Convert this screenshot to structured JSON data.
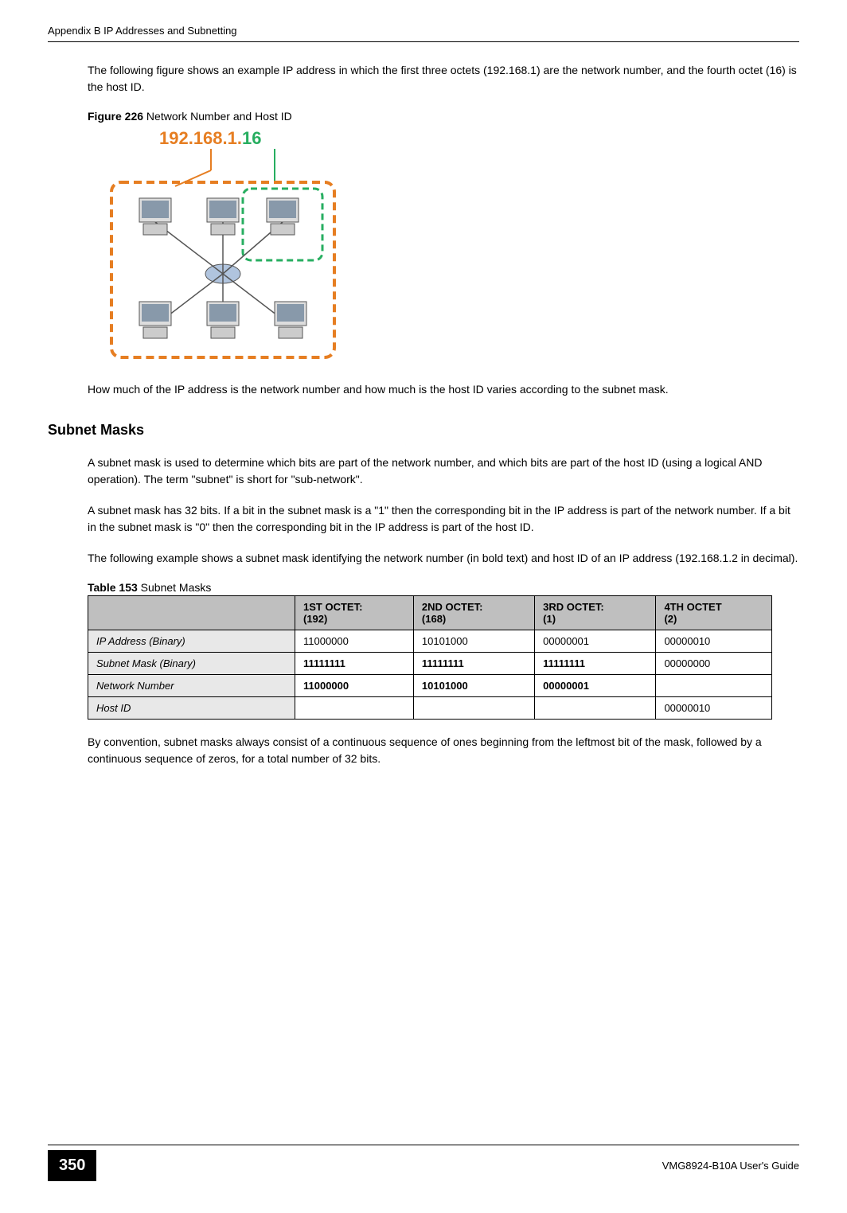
{
  "header": "Appendix B IP Addresses and Subnetting",
  "paragraph1": "The following figure shows an example IP address in which the first three octets (192.168.1) are the network number, and the fourth octet (16) is the host ID.",
  "figure_caption_bold": "Figure 226",
  "figure_caption_text": "   Network Number and Host ID",
  "ip_network": "192.168.1.",
  "ip_host": "16",
  "paragraph2": "How much of the IP address is the network number and how much is the host ID varies according to the subnet mask.",
  "section_heading": "Subnet Masks",
  "paragraph3": "A subnet mask is used to determine which bits are part of the network number, and which bits are part of the host ID (using a logical AND operation). The term \"subnet\" is short for \"sub-network\".",
  "paragraph4": "A subnet mask has 32 bits. If a bit in the subnet mask is a \"1\" then the corresponding bit in the IP address is part of the network number. If a bit in the subnet mask is \"0\" then the corresponding bit in the IP address is part of the host ID.",
  "paragraph5": "The following example shows a subnet mask identifying the network number (in bold text) and host ID of an IP address (192.168.1.2 in decimal).",
  "table_caption_bold": "Table 153",
  "table_caption_text": "   Subnet Masks",
  "table": {
    "headers": [
      "",
      "1ST OCTET:\n(192)",
      "2ND OCTET:\n(168)",
      "3RD OCTET:\n(1)",
      "4TH OCTET\n(2)"
    ],
    "rows": [
      {
        "label": "IP Address (Binary)",
        "cells": [
          "11000000",
          "10101000",
          "00000001",
          "00000010"
        ],
        "bold": [
          false,
          false,
          false,
          false
        ]
      },
      {
        "label": "Subnet Mask (Binary)",
        "cells": [
          "11111111",
          "11111111",
          "11111111",
          "00000000"
        ],
        "bold": [
          true,
          true,
          true,
          false
        ]
      },
      {
        "label": "Network Number",
        "cells": [
          "11000000",
          "10101000",
          "00000001",
          ""
        ],
        "bold": [
          true,
          true,
          true,
          false
        ]
      },
      {
        "label": "Host ID",
        "cells": [
          "",
          "",
          "",
          "00000010"
        ],
        "bold": [
          false,
          false,
          false,
          false
        ]
      }
    ]
  },
  "paragraph6": "By convention, subnet masks always consist of a continuous sequence of ones beginning from the leftmost bit of the mask, followed by a continuous sequence of zeros, for a total number of 32 bits.",
  "page_number": "350",
  "footer_text": "VMG8924-B10A User's Guide"
}
